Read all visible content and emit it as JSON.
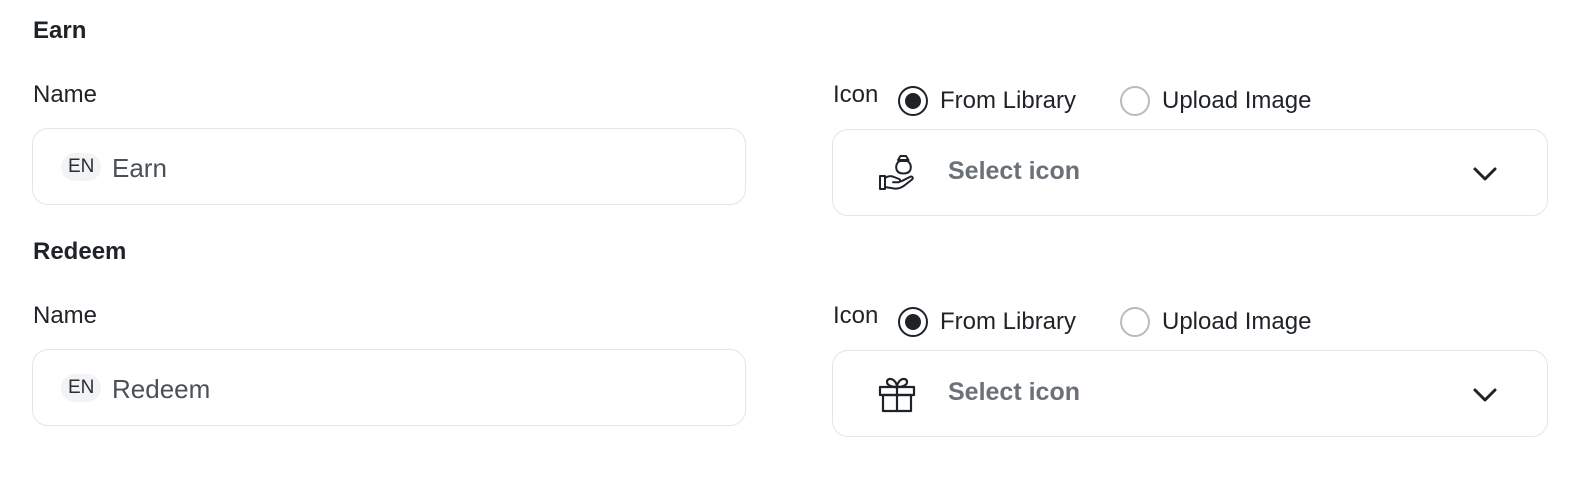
{
  "sections": [
    {
      "title": "Earn",
      "name_label": "Name",
      "lang_badge": "EN",
      "name_value": "Earn",
      "icon_label": "Icon",
      "options": [
        "From Library",
        "Upload Image"
      ],
      "selected_option": "From Library",
      "select_placeholder": "Select icon",
      "selected_icon": "money-bag-hand-icon"
    },
    {
      "title": "Redeem",
      "name_label": "Name",
      "lang_badge": "EN",
      "name_value": "Redeem",
      "icon_label": "Icon",
      "options": [
        "From Library",
        "Upload Image"
      ],
      "selected_option": "From Library",
      "select_placeholder": "Select icon",
      "selected_icon": "gift-icon"
    }
  ]
}
